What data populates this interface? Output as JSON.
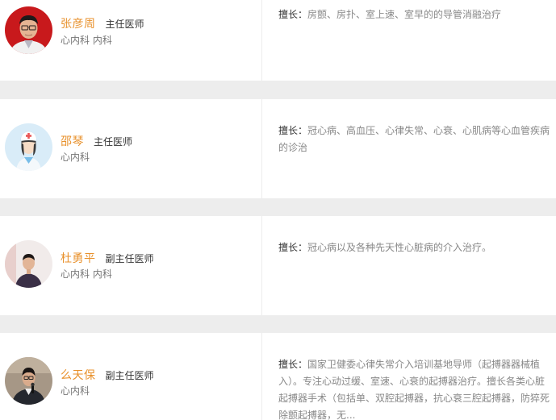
{
  "doctors": [
    {
      "name": "张彦周",
      "title": "主任医师",
      "department": "心内科 内科",
      "specialty_label": "擅长：",
      "specialty": "房颤、房扑、室上速、室早的的导管消融治疗",
      "avatar_icon": "doctor-photo-red-bg"
    },
    {
      "name": "邵琴",
      "title": "主任医师",
      "department": "心内科",
      "specialty_label": "擅长：",
      "specialty": "冠心病、高血压、心律失常、心衰、心肌病等心血管疾病的诊治",
      "avatar_icon": "nurse-placeholder-icon"
    },
    {
      "name": "杜勇平",
      "title": "副主任医师",
      "department": "心内科 内科",
      "specialty_label": "擅长：",
      "specialty": "冠心病以及各种先天性心脏病的介入治疗。",
      "avatar_icon": "doctor-photo-light-bg"
    },
    {
      "name": "么天保",
      "title": "副主任医师",
      "department": "心内科",
      "specialty_label": "擅长：",
      "specialty": "国家卫健委心律失常介入培训基地导师（起搏器器械植入）。专注心动过缓、室速、心衰的起搏器治疗。擅长各类心脏起搏器手术（包括单、双腔起搏器，抗心衰三腔起搏器，防猝死除颤起搏器，无...",
      "avatar_icon": "doctor-photo-speaking"
    }
  ],
  "colors": {
    "name": "#e8912c",
    "title": "#333333",
    "department": "#777777",
    "specialty": "#888888",
    "page_bg": "#ededed"
  }
}
